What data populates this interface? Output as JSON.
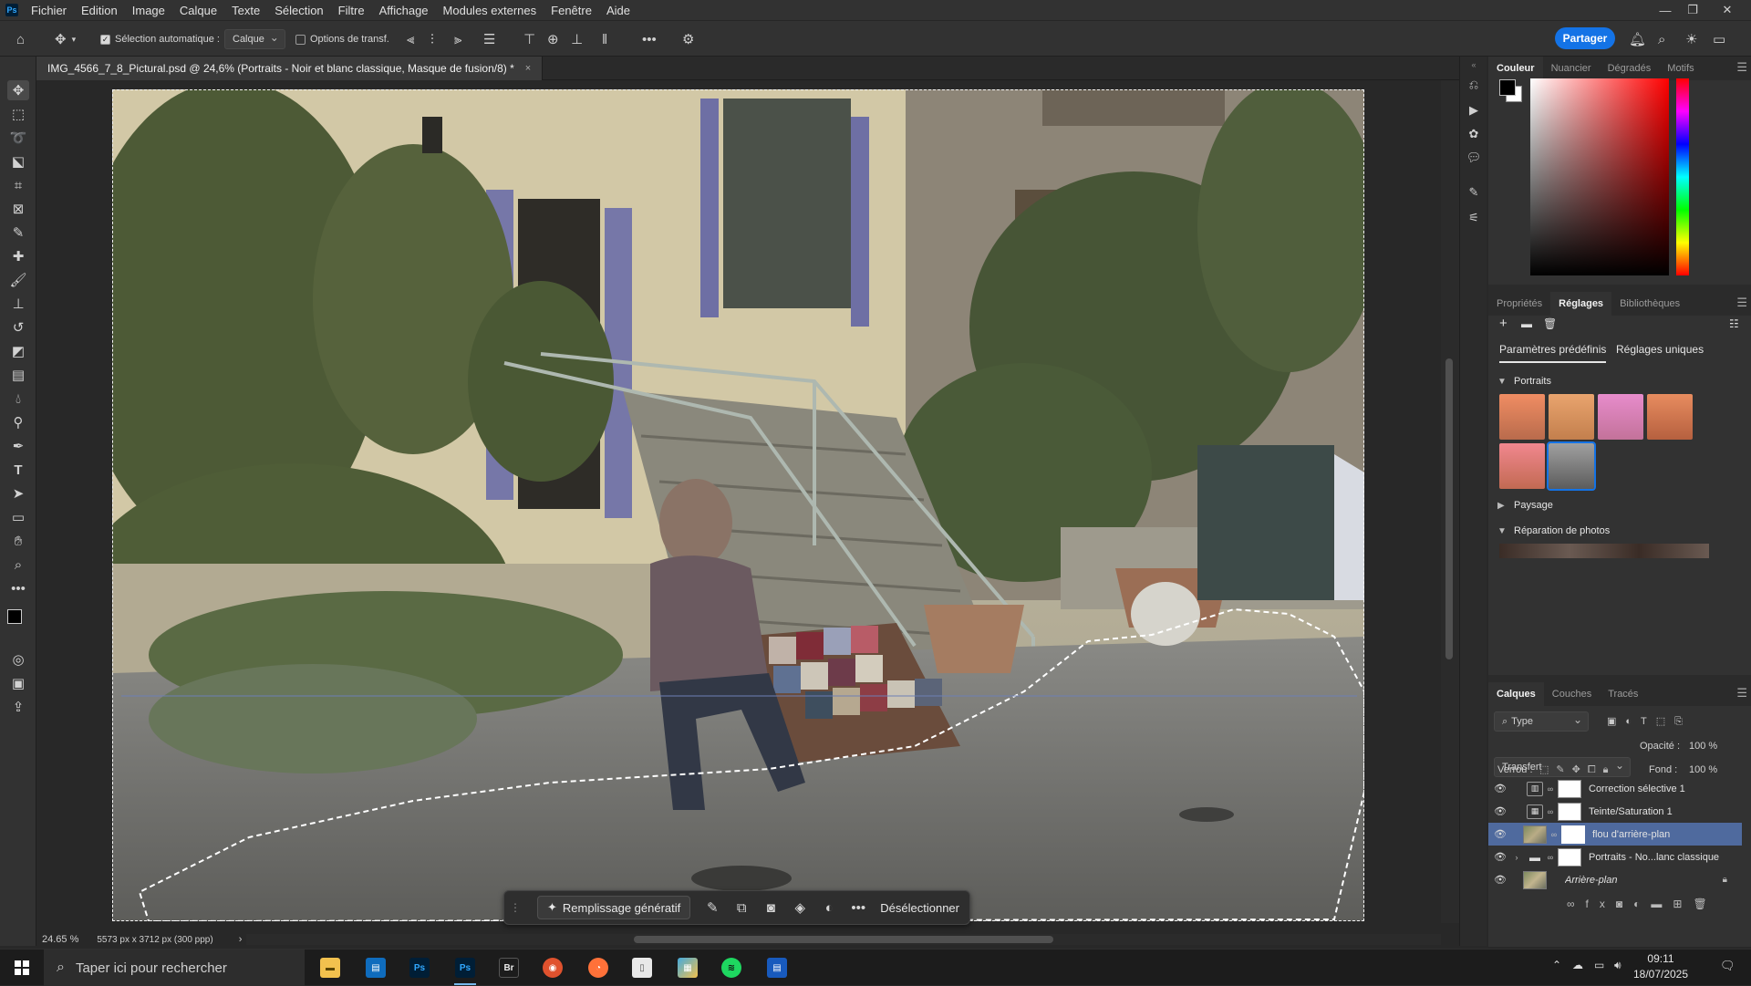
{
  "menubar": {
    "logo": "Ps",
    "items": [
      "Fichier",
      "Edition",
      "Image",
      "Calque",
      "Texte",
      "Sélection",
      "Filtre",
      "Affichage",
      "Modules externes",
      "Fenêtre",
      "Aide"
    ],
    "window_controls": [
      "—",
      "❐",
      "✕"
    ]
  },
  "options": {
    "auto_select_label": "Sélection automatique :",
    "auto_select_value": "Calque",
    "transform_options_label": "Options de transf.",
    "share_label": "Partager"
  },
  "document": {
    "tab_title": "IMG_4566_7_8_Pictural.psd @ 24,6% (Portraits - Noir et blanc classique, Masque de fusion/8) *",
    "close": "×"
  },
  "status": {
    "zoom": "24.65 %",
    "info": "5573 px x 3712 px (300 ppp)",
    "arrow": "›"
  },
  "contextual_bar": {
    "generative_fill": "Remplissage génératif",
    "deselect": "Désélectionner"
  },
  "color_panel": {
    "tabs": [
      "Couleur",
      "Nuancier",
      "Dégradés",
      "Motifs"
    ],
    "foreground": "#000000",
    "background": "#ffffff"
  },
  "adjustments_panel": {
    "tabs": [
      "Propriétés",
      "Réglages",
      "Bibliothèques"
    ],
    "subtabs": [
      "Paramètres prédéfinis",
      "Réglages uniques"
    ],
    "sections": [
      "Portraits",
      "Paysage",
      "Réparation de photos"
    ]
  },
  "layers_panel": {
    "tabs": [
      "Calques",
      "Couches",
      "Tracés"
    ],
    "filter_value": "Type",
    "blend_mode": "Transfert",
    "opacity_label": "Opacité :",
    "opacity_value": "100 %",
    "lock_label": "Verrou :",
    "fill_label": "Fond :",
    "fill_value": "100 %",
    "layers": [
      {
        "name": "Correction sélective 1",
        "type": "adjustment",
        "selected": false
      },
      {
        "name": "Teinte/Saturation 1",
        "type": "adjustment",
        "selected": false
      },
      {
        "name": "flou d'arrière-plan",
        "type": "pixel",
        "selected": true
      },
      {
        "name": "Portraits - No...lanc classique",
        "type": "group",
        "selected": false
      },
      {
        "name": "Arrière-plan",
        "type": "background",
        "selected": false
      }
    ]
  },
  "taskbar": {
    "search_placeholder": "Taper ici pour rechercher",
    "time": "09:11",
    "date": "18/07/2025"
  }
}
